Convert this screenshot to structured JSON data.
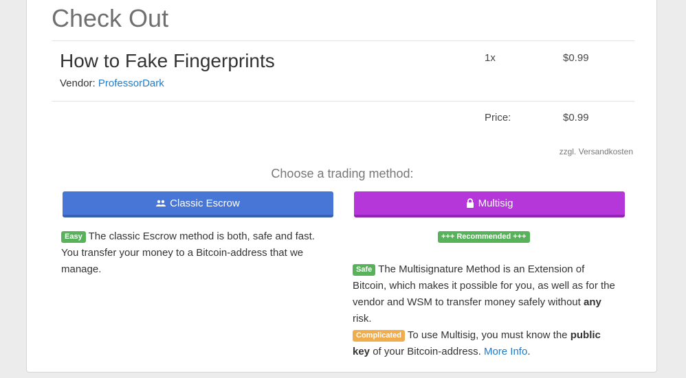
{
  "page": {
    "title": "Check Out"
  },
  "product": {
    "title": "How to Fake Fingerprints",
    "vendor_label": "Vendor:",
    "vendor_name": "ProfessorDark",
    "quantity": "1x",
    "amount": "$0.99"
  },
  "summary": {
    "price_label": "Price:",
    "price_value": "$0.99",
    "shipping_note": "zzgl. Versandkosten"
  },
  "trading": {
    "heading": "Choose a trading method:",
    "escrow": {
      "button_label": "Classic Escrow",
      "icon": "users-icon",
      "badge": "Easy",
      "description": "The classic Escrow method is both, safe and fast. You transfer your money to a Bitcoin-address that we manage."
    },
    "multisig": {
      "button_label": "Multisig",
      "icon": "lock-icon",
      "recommended_badge": "+++ Recommended +++",
      "safe_badge": "Safe",
      "safe_text_1": "The Multisignature Method is an Extension of Bitcoin, which makes it possible for you, as well as for the vendor and WSM to transfer money safely without",
      "safe_bold": "any",
      "safe_text_2": "risk.",
      "complicated_badge": "Complicated",
      "complicated_text_1": "To use Multisig, you must know the",
      "complicated_bold": "public key",
      "complicated_text_2": "of your Bitcoin-address.",
      "more_info_link": "More Info",
      "end_period": "."
    }
  },
  "colors": {
    "escrow_button": "#4876d6",
    "multisig_button": "#b536d9",
    "badge_green": "#57b25a",
    "badge_orange": "#f0ad4e",
    "link": "#1f7ac9"
  }
}
